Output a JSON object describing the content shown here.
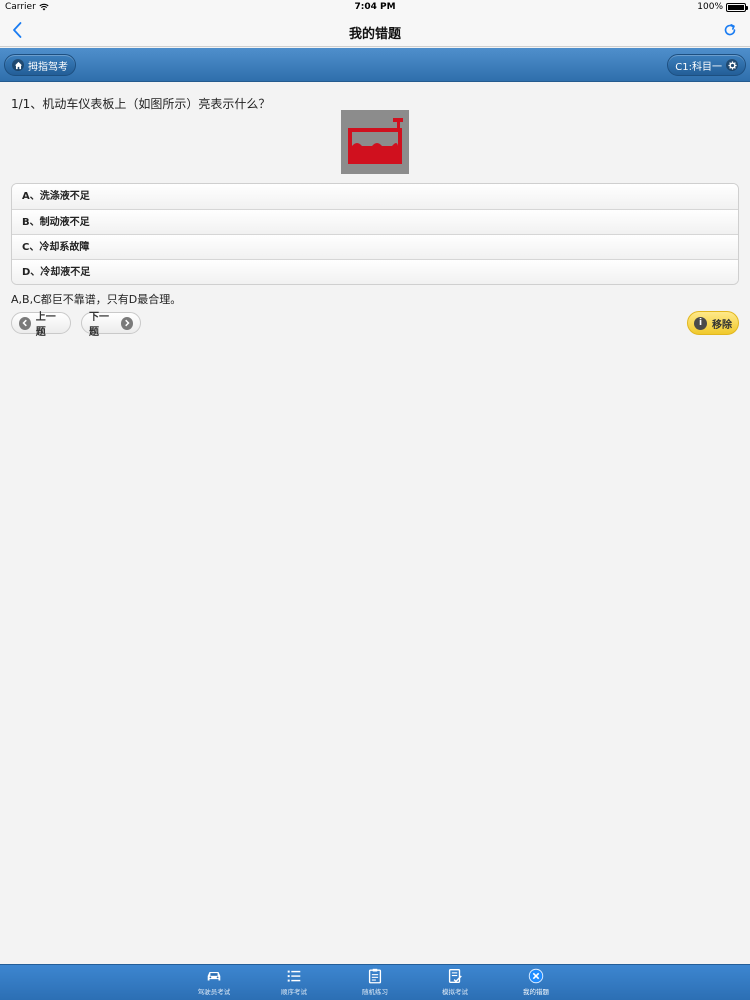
{
  "status_bar": {
    "carrier": "Carrier",
    "time": "7:04 PM",
    "battery": "100%"
  },
  "nav": {
    "title": "我的错题"
  },
  "toolbar": {
    "home_label": "拇指驾考",
    "subject_label": "C1:科目一"
  },
  "question": {
    "text": "1/1、机动车仪表板上（如图所示）亮表示什么？",
    "image_icon": "coolant-warning-icon",
    "options": [
      {
        "label": "A、洗涤液不足"
      },
      {
        "label": "B、制动液不足"
      },
      {
        "label": "C、冷却系故障"
      },
      {
        "label": "D、冷却液不足"
      }
    ],
    "explanation": "A,B,C都巨不靠谱，只有D最合理。"
  },
  "controls": {
    "prev_label": "上一题",
    "next_label": "下一题",
    "remove_label": "移除"
  },
  "tabs": [
    {
      "label": "驾驶员考试",
      "icon": "car-icon",
      "active": false
    },
    {
      "label": "顺序考试",
      "icon": "list-icon",
      "active": false
    },
    {
      "label": "随机练习",
      "icon": "clipboard-icon",
      "active": false
    },
    {
      "label": "模拟考试",
      "icon": "exam-check-icon",
      "active": false
    },
    {
      "label": "我的错题",
      "icon": "wrong-x-icon",
      "active": true
    }
  ],
  "colors": {
    "toolbar_blue": "#2f6fac",
    "tabbar_blue": "#2c6fb4",
    "warning_red": "#d0101e",
    "remove_yellow": "#f0c92c"
  }
}
